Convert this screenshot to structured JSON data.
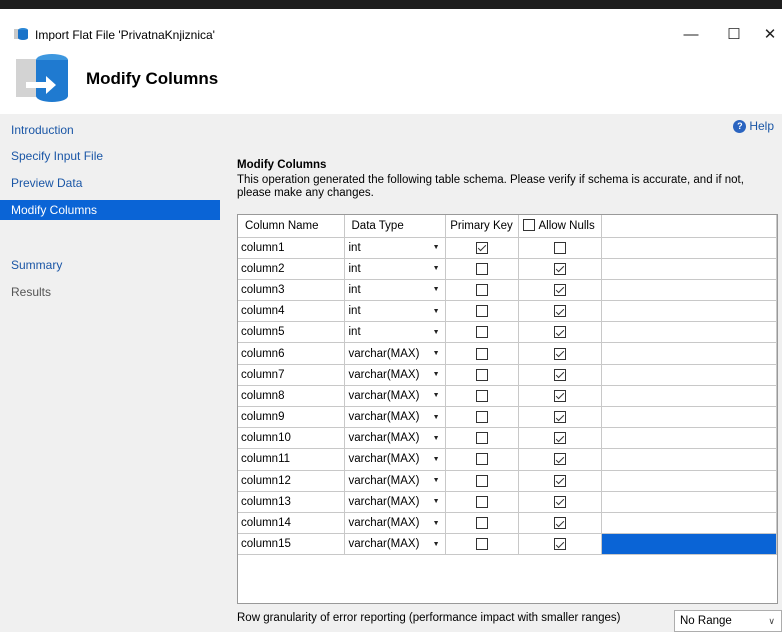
{
  "window": {
    "title": "Import Flat File 'PrivatnaKnjiznica'",
    "minimize_glyph": "—",
    "maximize_glyph": "☐",
    "close_glyph": "✕"
  },
  "header": {
    "title": "Modify Columns"
  },
  "nav": {
    "items": [
      {
        "label": "Introduction",
        "state": "link"
      },
      {
        "label": "Specify Input File",
        "state": "link"
      },
      {
        "label": "Preview Data",
        "state": "link"
      },
      {
        "label": "Modify Columns",
        "state": "active"
      },
      {
        "label": "Summary",
        "state": "link"
      },
      {
        "label": "Results",
        "state": "disabled"
      }
    ]
  },
  "help": {
    "label": "Help",
    "icon": "?"
  },
  "main": {
    "section_title": "Modify Columns",
    "description": "This operation generated the following table schema. Please verify if schema is accurate, and if not, please make any changes."
  },
  "grid": {
    "headers": {
      "column_name": "Column Name",
      "data_type": "Data Type",
      "primary_key": "Primary Key",
      "allow_nulls": "Allow Nulls"
    },
    "allow_nulls_header_checked": false,
    "rows": [
      {
        "name": "column1",
        "type": "int",
        "primary_key": true,
        "allow_nulls": false
      },
      {
        "name": "column2",
        "type": "int",
        "primary_key": false,
        "allow_nulls": true
      },
      {
        "name": "column3",
        "type": "int",
        "primary_key": false,
        "allow_nulls": true
      },
      {
        "name": "column4",
        "type": "int",
        "primary_key": false,
        "allow_nulls": true
      },
      {
        "name": "column5",
        "type": "int",
        "primary_key": false,
        "allow_nulls": true
      },
      {
        "name": "column6",
        "type": "varchar(MAX)",
        "primary_key": false,
        "allow_nulls": true
      },
      {
        "name": "column7",
        "type": "varchar(MAX)",
        "primary_key": false,
        "allow_nulls": true
      },
      {
        "name": "column8",
        "type": "varchar(MAX)",
        "primary_key": false,
        "allow_nulls": true
      },
      {
        "name": "column9",
        "type": "varchar(MAX)",
        "primary_key": false,
        "allow_nulls": true
      },
      {
        "name": "column10",
        "type": "varchar(MAX)",
        "primary_key": false,
        "allow_nulls": true
      },
      {
        "name": "column11",
        "type": "varchar(MAX)",
        "primary_key": false,
        "allow_nulls": true
      },
      {
        "name": "column12",
        "type": "varchar(MAX)",
        "primary_key": false,
        "allow_nulls": true
      },
      {
        "name": "column13",
        "type": "varchar(MAX)",
        "primary_key": false,
        "allow_nulls": true
      },
      {
        "name": "column14",
        "type": "varchar(MAX)",
        "primary_key": false,
        "allow_nulls": true
      },
      {
        "name": "column15",
        "type": "varchar(MAX)",
        "primary_key": false,
        "allow_nulls": true
      }
    ],
    "selected_row": "column15"
  },
  "footer": {
    "error_granularity_label": "Row granularity of error reporting (performance impact with smaller ranges)",
    "range_value": "No Range"
  },
  "colors": {
    "selection_blue": "#0a64d6",
    "link_blue": "#1a56a6",
    "panel_gray": "#f0f0f0"
  }
}
